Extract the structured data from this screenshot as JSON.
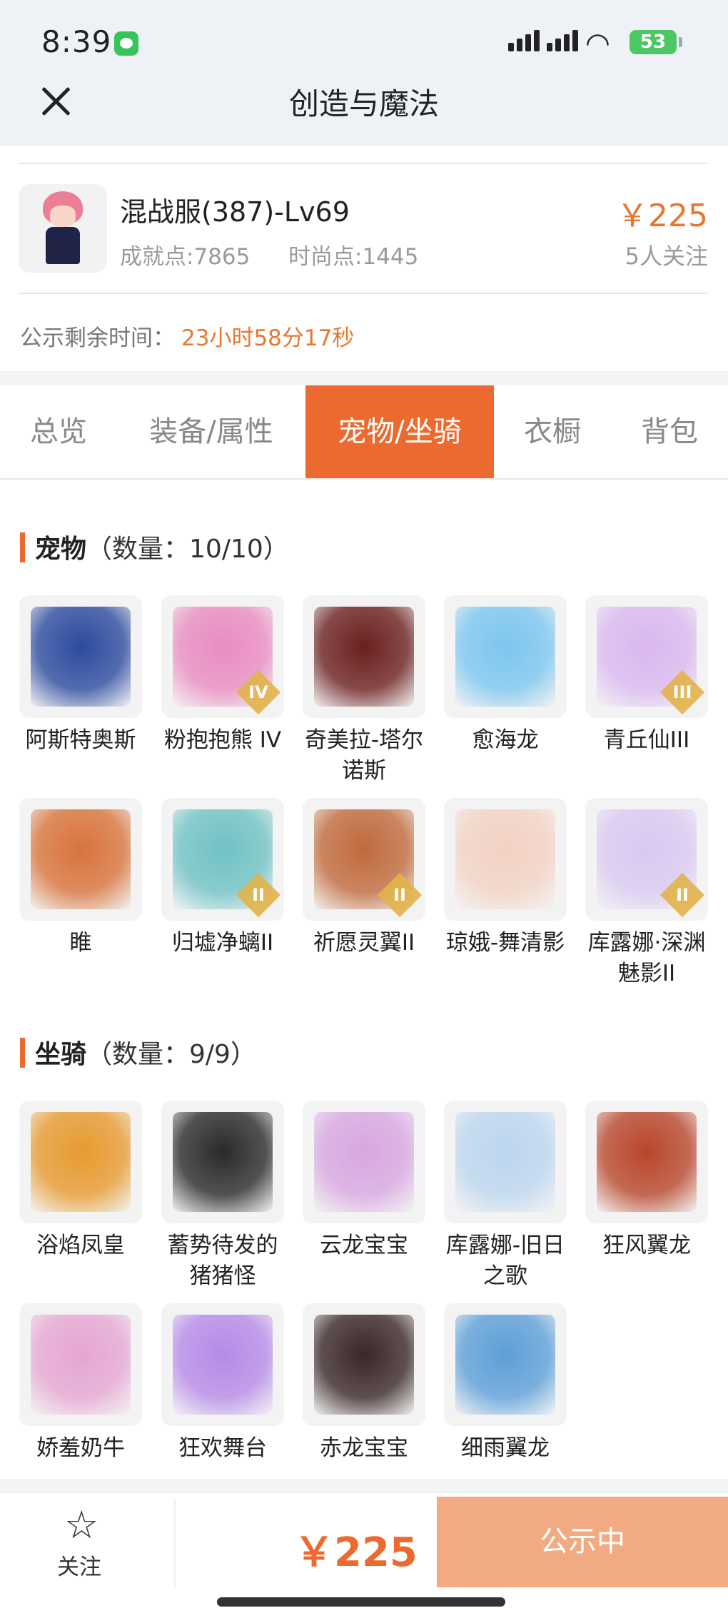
{
  "status_bar": {
    "time": "8:39",
    "battery": "53"
  },
  "nav": {
    "title": "创造与魔法"
  },
  "account": {
    "server": "混战服(387)-Lv69",
    "achievement": "成就点:7865",
    "fashion": "时尚点:1445",
    "price": "￥225",
    "followers": "5人关注",
    "timer_label": "公示剩余时间：",
    "timer_value": "23小时58分17秒"
  },
  "tabs": [
    {
      "label": "总览"
    },
    {
      "label": "装备/属性"
    },
    {
      "label": "宠物/坐骑"
    },
    {
      "label": "衣橱"
    },
    {
      "label": "背包"
    }
  ],
  "active_tab": "宠物/坐骑",
  "pets": {
    "title": "宠物",
    "count": "（数量：10/10）",
    "items": [
      {
        "name": "阿斯特奥斯",
        "color": "#2c4a9e",
        "badge": ""
      },
      {
        "name": "粉抱抱熊 IV",
        "color": "#e98cc1",
        "badge": "IV"
      },
      {
        "name": "奇美拉-塔尔诺斯",
        "color": "#6b1f1f",
        "badge": ""
      },
      {
        "name": "愈海龙",
        "color": "#7cc6ef",
        "badge": ""
      },
      {
        "name": "青丘仙III",
        "color": "#d9b8f0",
        "badge": "III"
      },
      {
        "name": "睢",
        "color": "#d8733a",
        "badge": ""
      },
      {
        "name": "归墟净螭II",
        "color": "#6fc2c4",
        "badge": "II"
      },
      {
        "name": "祈愿灵翼II",
        "color": "#c06a3c",
        "badge": "II"
      },
      {
        "name": "琼娥-舞清影",
        "color": "#f3d2c4",
        "badge": ""
      },
      {
        "name": "库露娜·深渊魅影II",
        "color": "#d9c9f2",
        "badge": "II"
      }
    ]
  },
  "mounts": {
    "title": "坐骑",
    "count": "（数量：9/9）",
    "items": [
      {
        "name": "浴焰凤皇",
        "color": "#e79a2f",
        "badge": ""
      },
      {
        "name": "蓄势待发的猪猪怪",
        "color": "#2a2a2a",
        "badge": ""
      },
      {
        "name": "云龙宝宝",
        "color": "#d7a7e0",
        "badge": ""
      },
      {
        "name": "库露娜-旧日之歌",
        "color": "#bcd6ef",
        "badge": ""
      },
      {
        "name": "狂风翼龙",
        "color": "#b8462b",
        "badge": ""
      },
      {
        "name": "娇羞奶牛",
        "color": "#e6a6d2",
        "badge": ""
      },
      {
        "name": "狂欢舞台",
        "color": "#b68ae8",
        "badge": ""
      },
      {
        "name": "赤龙宝宝",
        "color": "#3a2727",
        "badge": ""
      },
      {
        "name": "细雨翼龙",
        "color": "#5d9fd8",
        "badge": ""
      }
    ]
  },
  "footer": {
    "follow_label": "关注",
    "price": "￥225",
    "status_button": "公示中"
  },
  "colors": {
    "accent": "#ec6a2f",
    "price": "#e8762e"
  }
}
